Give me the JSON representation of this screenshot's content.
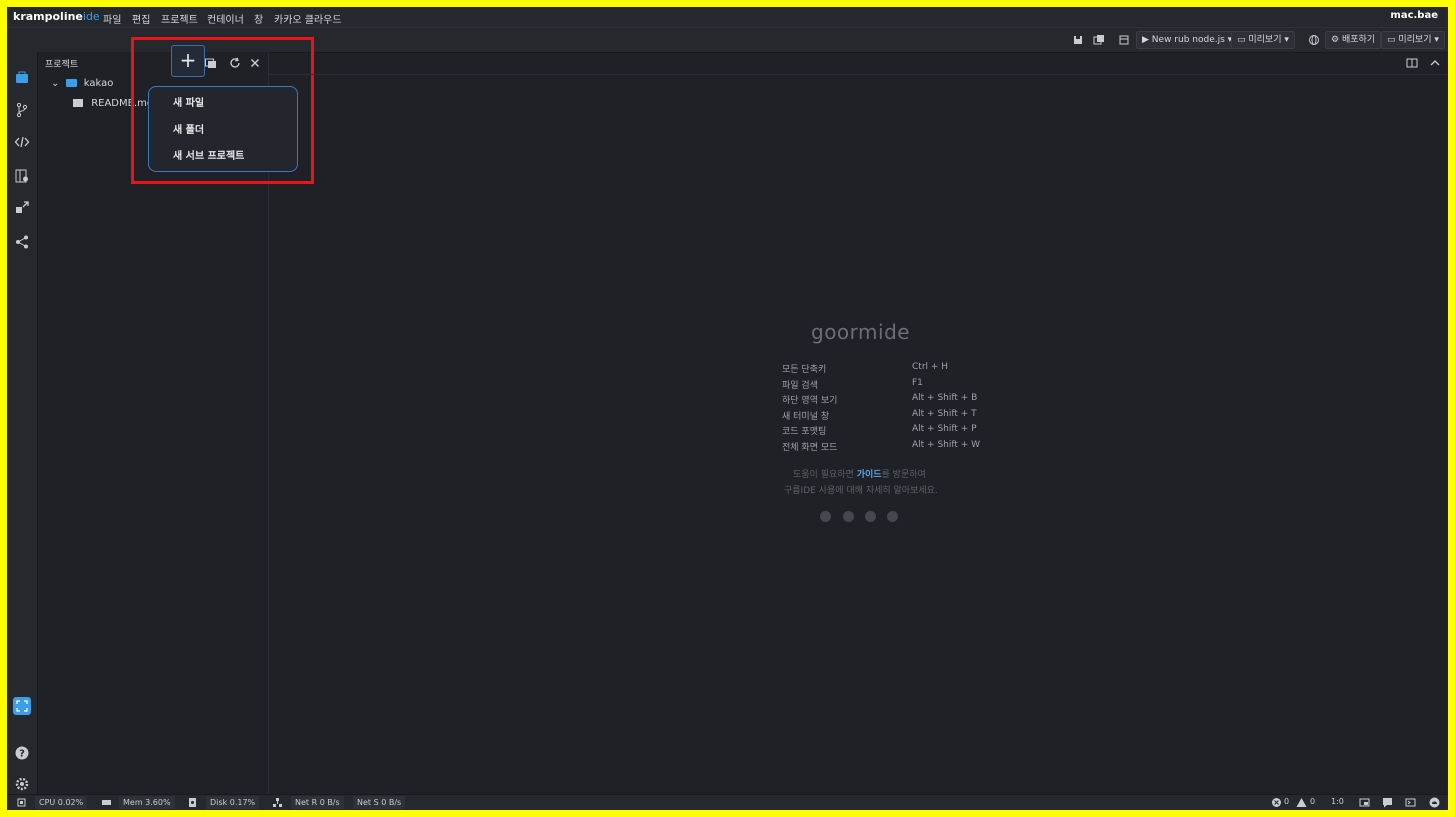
{
  "app": {
    "logo_main": "krampoline",
    "logo_suffix": "ide",
    "user": "mac.bae"
  },
  "menu": [
    "파일",
    "편집",
    "프로젝트",
    "컨테이너",
    "창",
    "카카오 클라우드"
  ],
  "toolbar": {
    "run_label": "New rub node.js",
    "preview_label": "미리보기",
    "deploy_label": "배포하기",
    "preview2_label": "미리보기"
  },
  "panel": {
    "title": "프로젝트",
    "tree": {
      "root": "kakao",
      "children": [
        "README.md"
      ]
    }
  },
  "new_menu": {
    "items": [
      "새 파일",
      "새 폴더",
      "새 서브 프로젝트"
    ]
  },
  "editor": {
    "logo": "goormide",
    "shortcuts": [
      {
        "name": "모든 단축키",
        "key": "Ctrl + H"
      },
      {
        "name": "파일 검색",
        "key": "F1"
      },
      {
        "name": "하단 영역 보기",
        "key": "Alt + Shift + B"
      },
      {
        "name": "새 터미널 창",
        "key": "Alt + Shift + T"
      },
      {
        "name": "코드 포맷팅",
        "key": "Alt + Shift + P"
      },
      {
        "name": "전체 화면 모드",
        "key": "Alt + Shift + W"
      }
    ],
    "help_line1_pre": "도움이 필요하면 ",
    "help_line1_link": "가이드",
    "help_line1_post": "를 방문하여",
    "help_line2": "구름IDE 사용에 대해 자세히 알아보세요."
  },
  "status": {
    "cpu": "CPU 0.02%",
    "mem": "Mem 3.60%",
    "disk": "Disk 0.17%",
    "net_r": "Net R 0 B/s",
    "net_s": "Net S 0 B/s",
    "errors": "0",
    "warnings": "0",
    "cursor": "1:0"
  },
  "colors": {
    "accent": "#3a9ee8",
    "highlight": "#e8141c",
    "background": "#1f2126"
  }
}
